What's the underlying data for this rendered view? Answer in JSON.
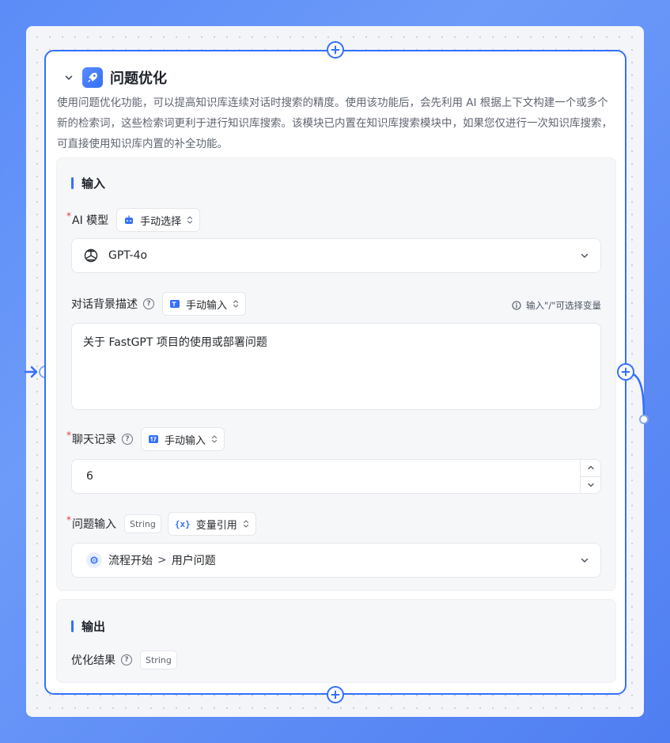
{
  "node": {
    "title": "问题优化",
    "description": "使用问题优化功能，可以提高知识库连续对话时搜索的精度。使用该功能后，会先利用 AI 根据上下文构建一个或多个新的检索词，这些检索词更利于进行知识库搜索。该模块已内置在知识库搜索模块中，如果您仅进行一次知识库搜索，可直接使用知识库内置的补全功能。"
  },
  "input_section": {
    "title": "输入",
    "model": {
      "label": "AI 模型",
      "mode": "手动选择",
      "value": "GPT-4o"
    },
    "background": {
      "label": "对话背景描述",
      "mode": "手动输入",
      "hint": "输入\"/\"可选择变量",
      "value": "关于 FastGPT 项目的使用或部署问题"
    },
    "history": {
      "label": "聊天记录",
      "mode": "手动输入",
      "value": "6"
    },
    "question": {
      "label": "问题输入",
      "type_tag": "String",
      "mode": "变量引用",
      "ref_source": "流程开始",
      "ref_sep": ">",
      "ref_field": "用户问题"
    }
  },
  "output_section": {
    "title": "输出",
    "result_label": "优化结果",
    "type_tag": "String"
  },
  "colors": {
    "accent": "#3370ff",
    "required": "#e03e3e"
  }
}
